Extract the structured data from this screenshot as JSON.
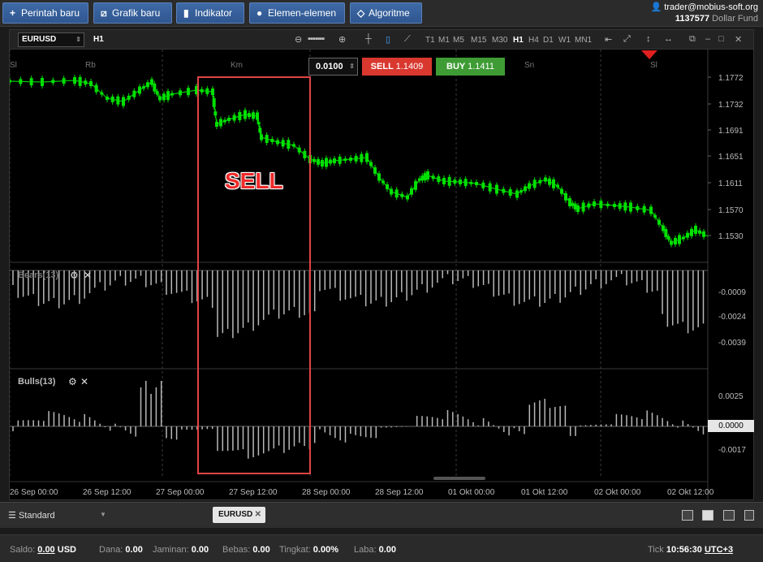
{
  "toolbar": {
    "new_order": "Perintah baru",
    "new_chart": "Grafik baru",
    "indicator": "Indikator",
    "elements": "Elemen-elemen",
    "algorithm": "Algoritme"
  },
  "account": {
    "user": "trader@mobius-soft.org",
    "number": "1137577",
    "fund": "Dollar Fund"
  },
  "chart": {
    "symbol": "EURUSD",
    "timeframe": "H1",
    "timeframes": [
      "T1",
      "M1",
      "M5",
      "M15",
      "M30",
      "H1",
      "H4",
      "D1",
      "W1",
      "MN1"
    ],
    "lot": "0.0100",
    "sell_label": "SELL",
    "sell_price": "1.1409",
    "buy_label": "BUY",
    "buy_price": "1.1411",
    "overlay_text": "SELL",
    "day_markers": [
      "Sl",
      "Rb",
      "Km",
      "Sn",
      "Sl"
    ],
    "price_ticks": [
      "1.1772",
      "1.1732",
      "1.1691",
      "1.1651",
      "1.1611",
      "1.1570",
      "1.1530"
    ],
    "bears_label": "Bears(13)",
    "bears_ticks": [
      "-0.0009",
      "-0.0024",
      "-0.0039"
    ],
    "bulls_label": "Bulls(13)",
    "bulls_ticks": [
      "0.0025",
      "0.0000",
      "-0.0017"
    ],
    "time_ticks": [
      "26 Sep 00:00",
      "26 Sep 12:00",
      "27 Sep 00:00",
      "27 Sep 12:00",
      "28 Sep 00:00",
      "28 Sep 12:00",
      "01 Okt 00:00",
      "01 Okt 12:00",
      "02 Okt 00:00",
      "02 Okt 12:00"
    ],
    "colors": {
      "bull_candle": "#00e000",
      "sell": "#d9382f",
      "buy": "#3f9c35",
      "highlight": "#e04444"
    }
  },
  "tabs": {
    "layout": "Standard",
    "symbol_tab": "EURUSD"
  },
  "status": {
    "saldo_label": "Saldo:",
    "saldo_value": "0.00",
    "saldo_currency": "USD",
    "dana_label": "Dana:",
    "dana_value": "0.00",
    "jaminan_label": "Jaminan:",
    "jaminan_value": "0.00",
    "bebas_label": "Bebas:",
    "bebas_value": "0.00",
    "tingkat_label": "Tingkat:",
    "tingkat_value": "0.00%",
    "laba_label": "Laba:",
    "laba_value": "0.00",
    "tick_label": "Tick",
    "time": "10:56:30",
    "timezone": "UTC+3"
  }
}
